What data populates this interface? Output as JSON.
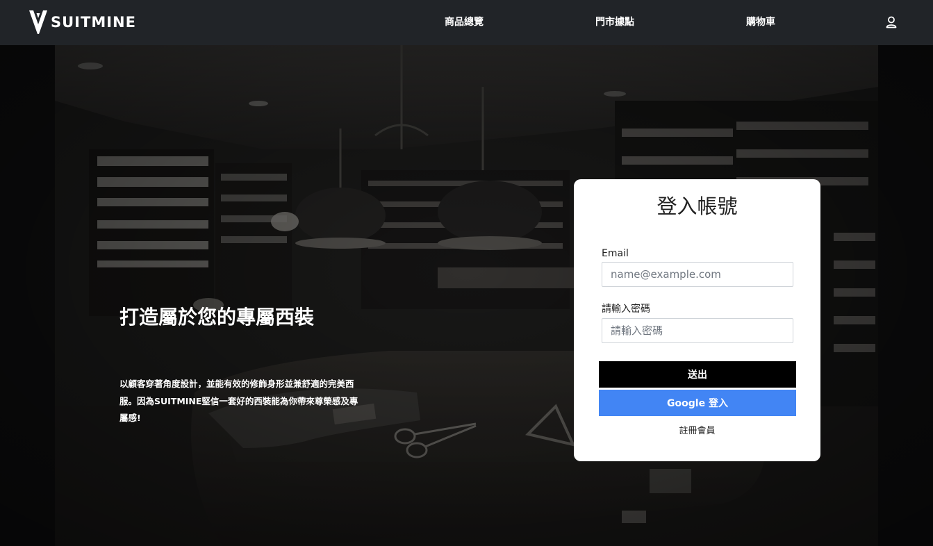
{
  "brand": {
    "name": "SUITMINE"
  },
  "nav": {
    "items": [
      {
        "label": "商品總覽"
      },
      {
        "label": "門市據點"
      },
      {
        "label": "購物車"
      }
    ],
    "user_icon": "user-icon"
  },
  "hero": {
    "title": "打造屬於您的專屬西裝",
    "description": "以顧客穿著角度設計，並能有效的修飾身形並兼舒適的完美西服。因為SUITMINE堅信一套好的西裝能為你帶來尊榮感及專屬感!"
  },
  "login": {
    "title": "登入帳號",
    "email_label": "Email",
    "email_placeholder": "name@example.com",
    "email_value": "",
    "password_label": "請輸入密碼",
    "password_placeholder": "請輸入密碼",
    "password_value": "",
    "submit_label": "送出",
    "google_label": "Google 登入",
    "register_label": "註冊會員"
  },
  "colors": {
    "navbar": "#212428",
    "card": "#ffffff",
    "submit_button": "#000000",
    "google_button": "#4285f4"
  }
}
